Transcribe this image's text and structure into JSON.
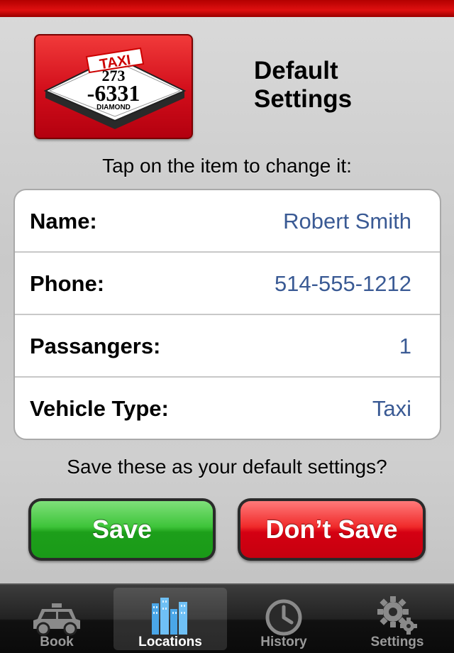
{
  "colors": {
    "brand_red": "#d10d1a",
    "value_blue": "#3a5a94",
    "save_green": "#2db52a"
  },
  "logo": {
    "top_word": "TAXI",
    "line1": "273",
    "line2": "-6331",
    "bottom_word": "DIAMOND"
  },
  "page": {
    "title_line1": "Default",
    "title_line2": "Settings"
  },
  "instruction": "Tap on the item to change it:",
  "settings": [
    {
      "label": "Name:",
      "value": "Robert Smith"
    },
    {
      "label": "Phone:",
      "value": "514-555-1212"
    },
    {
      "label": "Passangers:",
      "value": "1"
    },
    {
      "label": "Vehicle Type:",
      "value": "Taxi"
    }
  ],
  "question": "Save these as your default settings?",
  "buttons": {
    "save": "Save",
    "dont_save": "Don’t Save"
  },
  "tabs": [
    {
      "label": "Book",
      "icon": "car-icon",
      "selected": false
    },
    {
      "label": "Locations",
      "icon": "city-buildings-icon",
      "selected": true
    },
    {
      "label": "History",
      "icon": "clock-icon",
      "selected": false
    },
    {
      "label": "Settings",
      "icon": "gears-icon",
      "selected": false
    }
  ]
}
